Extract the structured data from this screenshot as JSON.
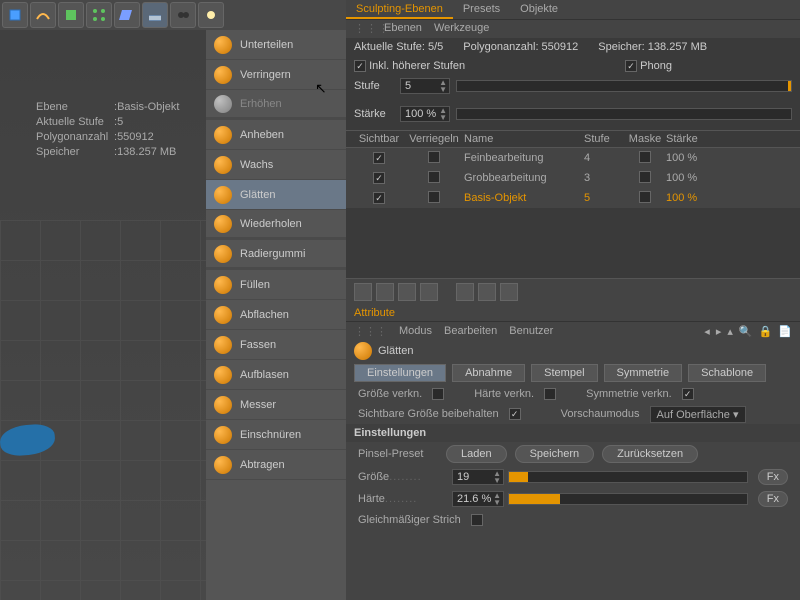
{
  "info": {
    "ebene_label": "Ebene",
    "ebene": "Basis-Objekt",
    "stufe_label": "Aktuelle Stufe",
    "stufe": "5",
    "poly_label": "Polygonanzahl",
    "poly": "550912",
    "mem_label": "Speicher",
    "mem": "138.257 MB"
  },
  "tools": [
    {
      "label": "Unterteilen"
    },
    {
      "label": "Verringern"
    },
    {
      "label": "Erhöhen"
    },
    {
      "label": "Anheben"
    },
    {
      "label": "Wachs"
    },
    {
      "label": "Glätten"
    },
    {
      "label": "Wiederholen"
    },
    {
      "label": "Radiergummi"
    },
    {
      "label": "Füllen"
    },
    {
      "label": "Abflachen"
    },
    {
      "label": "Fassen"
    },
    {
      "label": "Aufblasen"
    },
    {
      "label": "Messer"
    },
    {
      "label": "Einschnüren"
    },
    {
      "label": "Abtragen"
    }
  ],
  "main_tabs": {
    "t0": "Sculpting-Ebenen",
    "t1": "Presets",
    "t2": "Objekte"
  },
  "sub": {
    "s0": "Ebenen",
    "s1": "Werkzeuge"
  },
  "status": {
    "stufe": "Aktuelle Stufe: 5/5",
    "poly": "Polygonanzahl: 550912",
    "mem": "Speicher:  138.257 MB"
  },
  "checks": {
    "inkl": "Inkl. höherer Stufen",
    "phong": "Phong"
  },
  "level": {
    "label": "Stufe",
    "val": "5"
  },
  "strength": {
    "label": "Stärke",
    "val": "100 %"
  },
  "hdr": {
    "vis": "Sichtbar",
    "lock": "Verriegeln",
    "name": "Name",
    "lvl": "Stufe",
    "mask": "Maske",
    "str": "Stärke"
  },
  "layers": [
    {
      "name": "Feinbearbeitung",
      "lvl": "4",
      "str": "100 %"
    },
    {
      "name": "Grobbearbeitung",
      "lvl": "3",
      "str": "100 %"
    },
    {
      "name": "Basis-Objekt",
      "lvl": "5",
      "str": "100 %"
    }
  ],
  "attr": {
    "title": "Attribute",
    "menu": {
      "m0": "Modus",
      "m1": "Bearbeiten",
      "m2": "Benutzer"
    },
    "tool": "Glätten",
    "tabs": {
      "t0": "Einstellungen",
      "t1": "Abnahme",
      "t2": "Stempel",
      "t3": "Symmetrie",
      "t4": "Schablone"
    },
    "c1": "Größe verkn.",
    "c2": "Härte verkn.",
    "c3": "Symmetrie verkn.",
    "c4": "Sichtbare Größe beibehalten",
    "c5": "Vorschaumodus",
    "c5v": "Auf Oberfläche",
    "sec": "Einstellungen",
    "preset_label": "Pinsel-Preset",
    "b1": "Laden",
    "b2": "Speichern",
    "b3": "Zurücksetzen",
    "size_label": "Größe",
    "size": "19",
    "hard_label": "Härte",
    "hard": "21.6 %",
    "stroke": "Gleichmäßiger Strich",
    "fx": "Fx"
  }
}
